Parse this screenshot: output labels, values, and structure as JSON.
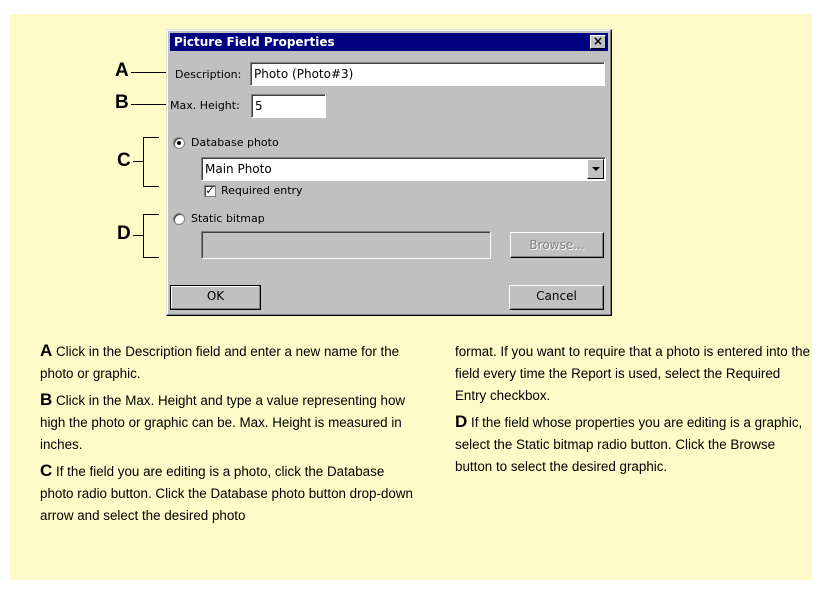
{
  "dialog": {
    "title": "Picture Field Properties",
    "close_symbol": "×",
    "description_label": "Description:",
    "description_value": "Photo (Photo#3)",
    "max_height_label": "Max. Height:",
    "max_height_value": "5",
    "database_photo_label": "Database photo",
    "database_photo_selected": true,
    "photo_select_value": "Main Photo",
    "required_entry_label": "Required entry",
    "required_entry_checked": true,
    "static_bitmap_label": "Static bitmap",
    "static_bitmap_value": "",
    "browse_label": "Browse...",
    "ok_label": "OK",
    "cancel_label": "Cancel"
  },
  "callouts": {
    "a": "A",
    "b": "B",
    "c": "C",
    "d": "D"
  },
  "text": {
    "a_letter": "A",
    "a_body": " Click in the Description field and enter a new name for the photo or graphic.",
    "b_letter": "B",
    "b_body": " Click in the Max. Height and type a value representing how high the photo or graphic can be. Max. Height is measured in inches.",
    "c_letter": "C",
    "c_body": " If the field you are editing is a photo, click the Database photo radio button. Click the Database photo button drop-down arrow and select the desired photo",
    "c_cont": "format. If you want to require that a photo is entered into the field every time the Report is used, select the Required Entry checkbox.",
    "d_letter": "D",
    "d_body": " If the field whose properties you are editing is a graphic, select the Static bitmap radio button. Click the Browse button to select the desired graphic."
  },
  "colors": {
    "panel": "#fefbc8",
    "titlebar": "#000080",
    "dialog_face": "#c0c0c0"
  }
}
